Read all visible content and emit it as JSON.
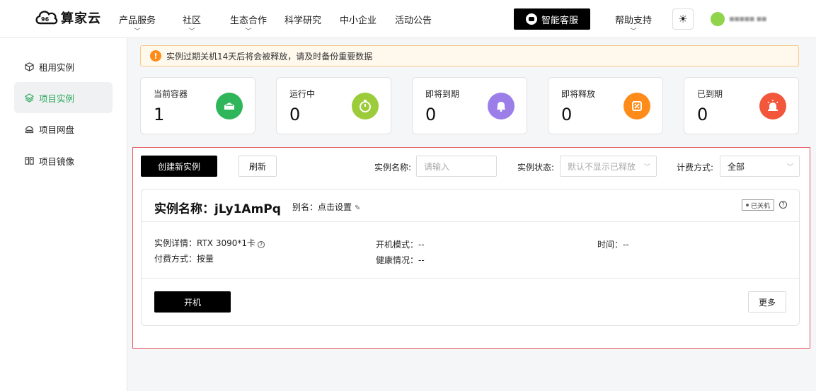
{
  "brand": {
    "name": "算家云"
  },
  "nav": {
    "items": [
      {
        "label": "产品服务",
        "chevron": true
      },
      {
        "label": "社区",
        "chevron": true
      },
      {
        "label": "生态合作",
        "chevron": true
      },
      {
        "label": "科学研究",
        "chevron": false
      },
      {
        "label": "中小企业",
        "chevron": false
      },
      {
        "label": "活动公告",
        "chevron": false
      }
    ],
    "service_button": "智能客服",
    "help": "帮助支持",
    "username": "▪▪▪▪▪ ▪▪"
  },
  "sidebar": {
    "items": [
      {
        "label": "租用实例",
        "icon": "cube-icon"
      },
      {
        "label": "项目实例",
        "icon": "layers-icon",
        "active": true
      },
      {
        "label": "项目网盘",
        "icon": "cloud-disk-icon"
      },
      {
        "label": "项目镜像",
        "icon": "image-icon"
      }
    ]
  },
  "notice": {
    "text": "实例过期关机14天后将会被释放，请及时备份重要数据"
  },
  "stats": [
    {
      "label": "当前容器",
      "value": "1",
      "color": "#2fb55a"
    },
    {
      "label": "运行中",
      "value": "0",
      "color": "#9ccc3a"
    },
    {
      "label": "即将到期",
      "value": "0",
      "color": "#9b7ee8"
    },
    {
      "label": "即将释放",
      "value": "0",
      "color": "#ff8c1a"
    },
    {
      "label": "已到期",
      "value": "0",
      "color": "#f2563b"
    }
  ],
  "toolbar": {
    "create_label": "创建新实例",
    "refresh_label": "刷新",
    "name_filter_label": "实例名称:",
    "name_filter_placeholder": "请输入",
    "status_filter_label": "实例状态:",
    "status_filter_value": "默认不显示已释放",
    "billing_filter_label": "计费方式:",
    "billing_filter_value": "全部"
  },
  "instance": {
    "title": "实例名称：jLy1AmPq",
    "alias": "别名：点击设置",
    "status": "已关机",
    "details_label": "实例详情：",
    "details_value": "RTX 3090*1卡",
    "pay_label": "付费方式：",
    "pay_value": "按量",
    "boot_mode": "开机模式：--",
    "health": "健康情况：--",
    "time": "时间：--",
    "start_label": "开机",
    "more_label": "更多"
  }
}
